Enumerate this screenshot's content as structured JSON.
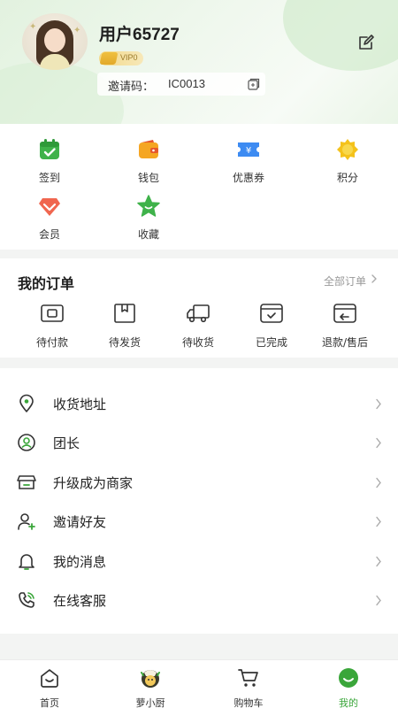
{
  "profile": {
    "username": "用户65727",
    "vip_level": "VIP0",
    "invite_label": "邀请码：",
    "invite_code": "IC0013"
  },
  "quick_actions": [
    {
      "label": "签到",
      "icon": "calendar-check-icon"
    },
    {
      "label": "钱包",
      "icon": "wallet-icon"
    },
    {
      "label": "优惠券",
      "icon": "coupon-icon"
    },
    {
      "label": "积分",
      "icon": "points-icon"
    },
    {
      "label": "会员",
      "icon": "member-gem-icon"
    },
    {
      "label": "收藏",
      "icon": "star-icon"
    }
  ],
  "orders": {
    "title": "我的订单",
    "all_label": "全部订单",
    "items": [
      {
        "label": "待付款",
        "icon": "wallet-card-icon"
      },
      {
        "label": "待发货",
        "icon": "box-icon"
      },
      {
        "label": "待收货",
        "icon": "truck-icon"
      },
      {
        "label": "已完成",
        "icon": "done-icon"
      },
      {
        "label": "退款/售后",
        "icon": "refund-icon"
      }
    ]
  },
  "menu": [
    {
      "label": "收货地址",
      "icon": "location-pin-icon"
    },
    {
      "label": "团长",
      "icon": "leader-user-icon"
    },
    {
      "label": "升级成为商家",
      "icon": "store-icon"
    },
    {
      "label": "邀请好友",
      "icon": "add-user-icon"
    },
    {
      "label": "我的消息",
      "icon": "bell-icon"
    },
    {
      "label": "在线客服",
      "icon": "phone-icon"
    }
  ],
  "tabs": [
    {
      "label": "首页",
      "icon": "home-icon"
    },
    {
      "label": "萝小厨",
      "icon": "chef-mascot-icon"
    },
    {
      "label": "购物车",
      "icon": "cart-icon"
    },
    {
      "label": "我的",
      "icon": "profile-smile-icon",
      "active": true
    }
  ],
  "colors": {
    "accent_green": "#3aa63a",
    "header_tint": "#e6f4e3",
    "wallet_orange": "#f5a623",
    "coupon_blue": "#3d8bf2",
    "points_yellow": "#f4c21b",
    "member_red": "#f0664f"
  }
}
